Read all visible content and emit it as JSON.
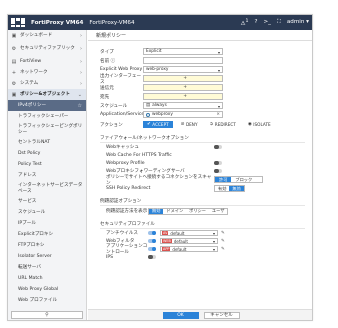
{
  "topbar": {
    "product": "FortiProxy VM64",
    "hostname": "FortiProxy-VM64",
    "bell_count": "1",
    "user": "admin"
  },
  "sidebar": {
    "items": [
      {
        "label": "ダッシュボード",
        "icon": "dashboard-icon"
      },
      {
        "label": "セキュリティファブリック",
        "icon": "fabric-icon"
      },
      {
        "label": "FortiView",
        "icon": "chart-icon"
      },
      {
        "label": "ネットワーク",
        "icon": "plus-icon"
      },
      {
        "label": "システム",
        "icon": "gear-icon"
      },
      {
        "label": "ポリシー&オブジェクト",
        "icon": "policy-icon"
      },
      {
        "label": "IPv4ポリシー"
      },
      {
        "label": "トラフィックシェーパー"
      },
      {
        "label": "トラフィックシェーピングポリシー"
      },
      {
        "label": "セントラルNAT"
      },
      {
        "label": "Dst Policy"
      },
      {
        "label": "Policy Test"
      },
      {
        "label": "アドレス"
      },
      {
        "label": "インターネットサービスデータベース"
      },
      {
        "label": "サービス"
      },
      {
        "label": "スケジュール"
      },
      {
        "label": "IPプール"
      },
      {
        "label": "Explicitプロキシ"
      },
      {
        "label": "FTPプロキシ"
      },
      {
        "label": "Isolator Server"
      },
      {
        "label": "転送サーバ"
      },
      {
        "label": "URL Match"
      },
      {
        "label": "Web Proxy Global"
      },
      {
        "label": "Web プロファイル"
      }
    ],
    "search_icon": "search-icon"
  },
  "main": {
    "title": "新規ポリシー",
    "fields": {
      "type_label": "タイプ",
      "type_value": "Explicit",
      "name_label": "名前",
      "explicit_label": "Explicit Web Proxy",
      "explicit_value": "web-proxy",
      "outgoing_label": "出力インターフェース",
      "src_label": "送信元",
      "dst_label": "宛先",
      "schedule_label": "スケジュール",
      "schedule_value": "always",
      "service_label": "Application/Service",
      "service_value": "webproxy",
      "action_label": "アクション"
    },
    "actions": [
      "ACCEPT",
      "DENY",
      "REDIRECT",
      "ISOLATE"
    ],
    "firewall_section": "ファイアウォール/ネットワークオプション",
    "toggles": [
      "Webキャッシュ",
      "Web Cache For HTTPS Traffic",
      "Webproxy Profile",
      "Webプロキシフォワーディングサーバ",
      "ポリシーでサイトへ接続するコネクションをスキャン",
      "SSH Policy Redirect"
    ],
    "scan_options": [
      "許可",
      "ブロック"
    ],
    "ssh_options": [
      "有効",
      "無効"
    ],
    "auth_section": "例題認証オプション",
    "auth_label": "例題認証方法を表示",
    "auth_options": [
      "無効",
      "ドメイン",
      "ポリシー",
      "ユーザ"
    ],
    "security_section": "セキュリティプロファイル",
    "profiles": [
      {
        "label": "アンチウイルス",
        "value": "default",
        "tag": "AV"
      },
      {
        "label": "Webフィルタ",
        "value": "default",
        "tag": "WEB"
      },
      {
        "label": "アプリケーションコントロール",
        "value": "default",
        "tag": "APP"
      },
      {
        "label": "IPS",
        "value": "",
        "tag": ""
      }
    ]
  },
  "footer": {
    "ok": "OK",
    "cancel": "キャンセル"
  }
}
